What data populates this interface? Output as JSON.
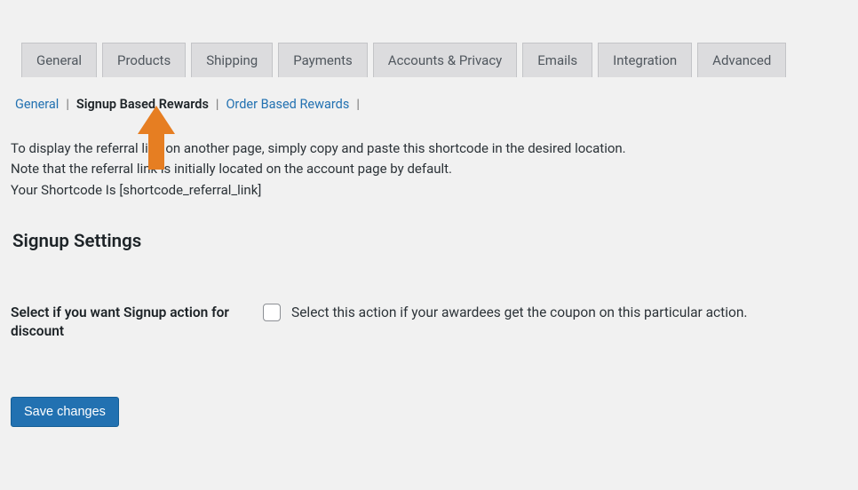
{
  "main_tabs": {
    "general": "General",
    "products": "Products",
    "shipping": "Shipping",
    "payments": "Payments",
    "accounts_privacy": "Accounts & Privacy",
    "emails": "Emails",
    "integration": "Integration",
    "advanced": "Advanced"
  },
  "sub_tabs": {
    "general": "General",
    "signup_based_rewards": "Signup Based Rewards",
    "order_based_rewards": "Order Based Rewards"
  },
  "description": {
    "line1": "To display the referral link on another page, simply copy and paste this shortcode in the desired location.",
    "line2": "Note that the referral link is initially located on the account page by default.",
    "line3": "Your Shortcode Is [shortcode_referral_link]"
  },
  "settings_heading": "Signup Settings",
  "form": {
    "label": "Select if you want Signup action for discount",
    "checkbox_text": "Select this action if your awardees get the coupon on this particular action."
  },
  "save_button": "Save changes",
  "colors": {
    "arrow": "#e67e22"
  }
}
